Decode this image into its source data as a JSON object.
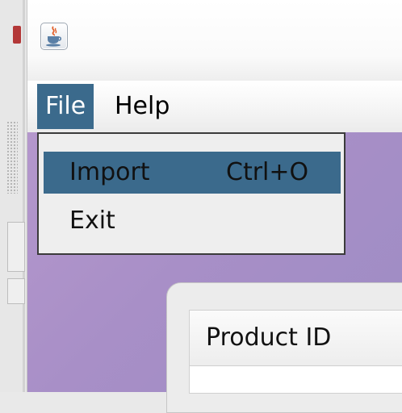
{
  "menu_bar": {
    "file_label": "File",
    "help_label": "Help"
  },
  "file_menu": {
    "items": [
      {
        "label": "Import",
        "accelerator": "Ctrl+O",
        "highlighted": true
      },
      {
        "label": "Exit"
      }
    ]
  },
  "table": {
    "columns": [
      "Product ID"
    ]
  },
  "icons": {
    "app_icon": "java-coffee-cup-icon"
  },
  "colors": {
    "selection": "#3b6a8c",
    "content_background": "#a892c8"
  }
}
